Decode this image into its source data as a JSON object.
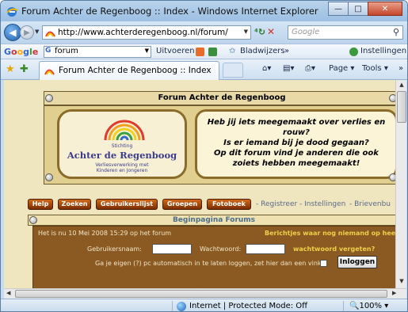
{
  "window": {
    "title": "Forum Achter de Regenboog :: Index - Windows Internet Explorer",
    "minimize": "—",
    "maximize": "□",
    "close": "✕"
  },
  "address": {
    "url": "http://www.achterderegenboog.nl/forum/",
    "search_placeholder": "Google"
  },
  "google_toolbar": {
    "logo": "Google",
    "search_value": "forum",
    "uitvoeren": "Uitvoeren",
    "bladwijzers": "Bladwijzers",
    "more": "»",
    "instellingen": "Instellingen"
  },
  "tab": {
    "label": "Forum Achter de Regenboog :: Index"
  },
  "commands": {
    "page": "Page",
    "tools": "Tools",
    "more": "»"
  },
  "forum": {
    "header": "Forum Achter de Regenboog",
    "logo_small_top": "Stichting",
    "logo_name": "Achter de Regenboog",
    "logo_small_line1": "Verliesverwerking met",
    "logo_small_line2": "Kinderen en Jongeren",
    "message_lines": [
      "Heb jij iets meegemaakt over verlies en",
      "rouw?",
      "Is er iemand bij je dood gegaan?",
      "Op dit forum vind je anderen die ook",
      "zoiets hebben meegemaakt!"
    ],
    "nav_buttons": [
      "Help",
      "Zoeken",
      "Gebruikerslijst",
      "Groepen",
      "Fotoboek"
    ],
    "nav_links": [
      "Registreer",
      "Instellingen",
      "Brievenbu"
    ],
    "panel_title": "Beginpagina Forums",
    "date_text": "Het is nu 10 Mei 2008 15:29 op het forum",
    "notice_text": "Berichtjes waar nog niemand op heeft ge",
    "username_label": "Gebruikersnaam:",
    "password_label": "Wachtwoord:",
    "forgot_link": "wachtwoord vergeten?",
    "auto_login_text": "Ga je eigen (?) pc automatisch in te laten loggen, zet hier dan een vinkje",
    "login_button": "Inloggen"
  },
  "status": {
    "zone": "Internet | Protected Mode: Off",
    "zoom": "100%"
  },
  "colors": {
    "page_bg": "#efe6bf",
    "panel_bg": "#8a5a22",
    "nav_button": "#b8520e",
    "accent_yellow": "#f0d048"
  }
}
